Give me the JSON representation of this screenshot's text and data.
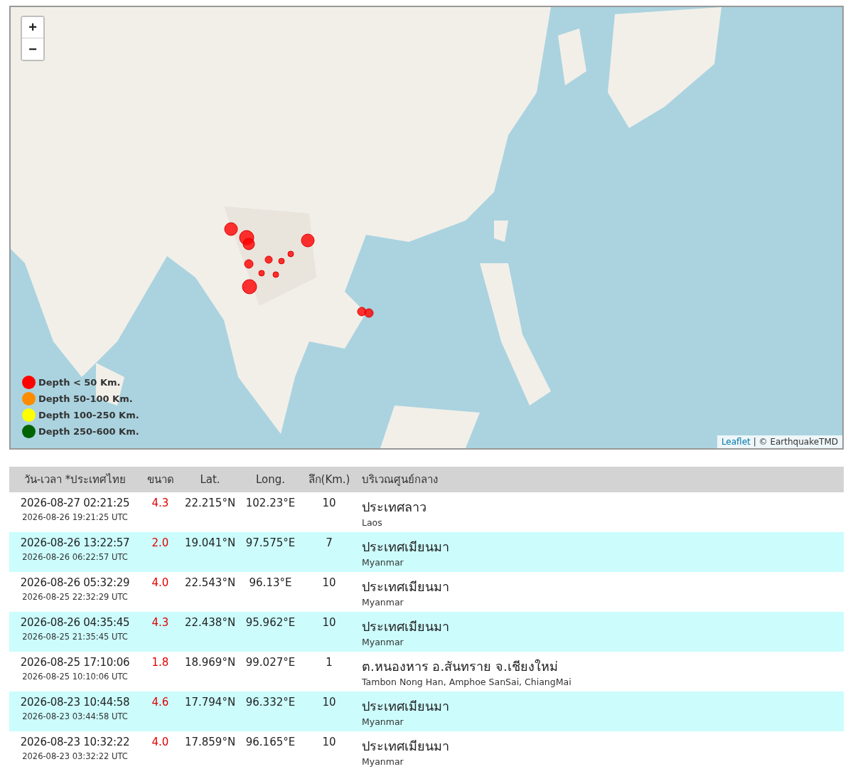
{
  "map": {
    "zoom_in": "+",
    "zoom_out": "−",
    "legend": [
      {
        "label": "Depth < 50 Km.",
        "color": "#ff0000"
      },
      {
        "label": "Depth 50-100 Km.",
        "color": "#ff8c00"
      },
      {
        "label": "Depth 100-250 Km.",
        "color": "#ffff00"
      },
      {
        "label": "Depth 250-600 Km.",
        "color": "#006400"
      }
    ],
    "attribution": {
      "link": "Leaflet",
      "text": "| © EarthquakeTMD"
    }
  },
  "table": {
    "columns": [
      "วัน-เวลา *ประเทศไทย",
      "ขนาด",
      "Lat.",
      "Long.",
      "ลึก(Km.)",
      "บริเวณศูนย์กลาง"
    ],
    "rows": [
      {
        "local_time": "2026-08-27 02:21:25",
        "utc_time": "2026-08-26 19:21:25 UTC",
        "magnitude": "4.3",
        "lat": "22.215°N",
        "long": "102.23°E",
        "depth": "10",
        "region_th": "ประเทศลาว",
        "region_en": "Laos"
      },
      {
        "local_time": "2026-08-26 13:22:57",
        "utc_time": "2026-08-26 06:22:57 UTC",
        "magnitude": "2.0",
        "lat": "19.041°N",
        "long": "97.575°E",
        "depth": "7",
        "region_th": "ประเทศเมียนมา",
        "region_en": "Myanmar"
      },
      {
        "local_time": "2026-08-26 05:32:29",
        "utc_time": "2026-08-25 22:32:29 UTC",
        "magnitude": "4.0",
        "lat": "22.543°N",
        "long": "96.13°E",
        "depth": "10",
        "region_th": "ประเทศเมียนมา",
        "region_en": "Myanmar"
      },
      {
        "local_time": "2026-08-26 04:35:45",
        "utc_time": "2026-08-25 21:35:45 UTC",
        "magnitude": "4.3",
        "lat": "22.438°N",
        "long": "95.962°E",
        "depth": "10",
        "region_th": "ประเทศเมียนมา",
        "region_en": "Myanmar"
      },
      {
        "local_time": "2026-08-25 17:10:06",
        "utc_time": "2026-08-25 10:10:06 UTC",
        "magnitude": "1.8",
        "lat": "18.969°N",
        "long": "99.027°E",
        "depth": "1",
        "region_th": "ต.หนองหาร อ.สันทราย จ.เชียงใหม่",
        "region_en": "Tambon Nong Han, Amphoe SanSai, ChiangMai"
      },
      {
        "local_time": "2026-08-23 10:44:58",
        "utc_time": "2026-08-23 03:44:58 UTC",
        "magnitude": "4.6",
        "lat": "17.794°N",
        "long": "96.332°E",
        "depth": "10",
        "region_th": "ประเทศเมียนมา",
        "region_en": "Myanmar"
      },
      {
        "local_time": "2026-08-23 10:32:22",
        "utc_time": "2026-08-23 03:32:22 UTC",
        "magnitude": "4.0",
        "lat": "17.859°N",
        "long": "96.165°E",
        "depth": "10",
        "region_th": "ประเทศเมียนมา",
        "region_en": "Myanmar"
      }
    ]
  }
}
